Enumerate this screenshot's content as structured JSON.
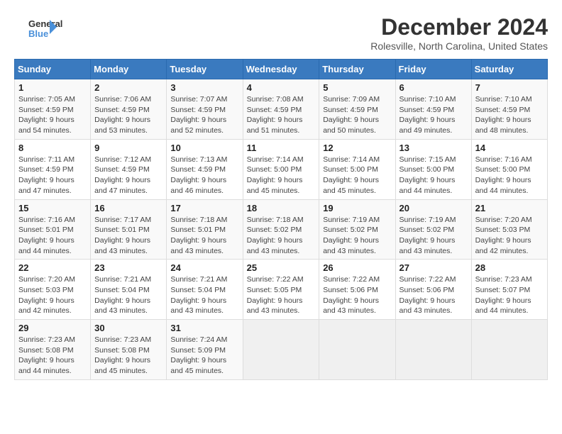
{
  "logo": {
    "text_general": "General",
    "text_blue": "Blue"
  },
  "header": {
    "month": "December 2024",
    "location": "Rolesville, North Carolina, United States"
  },
  "weekdays": [
    "Sunday",
    "Monday",
    "Tuesday",
    "Wednesday",
    "Thursday",
    "Friday",
    "Saturday"
  ],
  "weeks": [
    [
      {
        "day": "1",
        "sunrise": "7:05 AM",
        "sunset": "4:59 PM",
        "daylight": "9 hours and 54 minutes."
      },
      {
        "day": "2",
        "sunrise": "7:06 AM",
        "sunset": "4:59 PM",
        "daylight": "9 hours and 53 minutes."
      },
      {
        "day": "3",
        "sunrise": "7:07 AM",
        "sunset": "4:59 PM",
        "daylight": "9 hours and 52 minutes."
      },
      {
        "day": "4",
        "sunrise": "7:08 AM",
        "sunset": "4:59 PM",
        "daylight": "9 hours and 51 minutes."
      },
      {
        "day": "5",
        "sunrise": "7:09 AM",
        "sunset": "4:59 PM",
        "daylight": "9 hours and 50 minutes."
      },
      {
        "day": "6",
        "sunrise": "7:10 AM",
        "sunset": "4:59 PM",
        "daylight": "9 hours and 49 minutes."
      },
      {
        "day": "7",
        "sunrise": "7:10 AM",
        "sunset": "4:59 PM",
        "daylight": "9 hours and 48 minutes."
      }
    ],
    [
      {
        "day": "8",
        "sunrise": "7:11 AM",
        "sunset": "4:59 PM",
        "daylight": "9 hours and 47 minutes."
      },
      {
        "day": "9",
        "sunrise": "7:12 AM",
        "sunset": "4:59 PM",
        "daylight": "9 hours and 47 minutes."
      },
      {
        "day": "10",
        "sunrise": "7:13 AM",
        "sunset": "4:59 PM",
        "daylight": "9 hours and 46 minutes."
      },
      {
        "day": "11",
        "sunrise": "7:14 AM",
        "sunset": "5:00 PM",
        "daylight": "9 hours and 45 minutes."
      },
      {
        "day": "12",
        "sunrise": "7:14 AM",
        "sunset": "5:00 PM",
        "daylight": "9 hours and 45 minutes."
      },
      {
        "day": "13",
        "sunrise": "7:15 AM",
        "sunset": "5:00 PM",
        "daylight": "9 hours and 44 minutes."
      },
      {
        "day": "14",
        "sunrise": "7:16 AM",
        "sunset": "5:00 PM",
        "daylight": "9 hours and 44 minutes."
      }
    ],
    [
      {
        "day": "15",
        "sunrise": "7:16 AM",
        "sunset": "5:01 PM",
        "daylight": "9 hours and 44 minutes."
      },
      {
        "day": "16",
        "sunrise": "7:17 AM",
        "sunset": "5:01 PM",
        "daylight": "9 hours and 43 minutes."
      },
      {
        "day": "17",
        "sunrise": "7:18 AM",
        "sunset": "5:01 PM",
        "daylight": "9 hours and 43 minutes."
      },
      {
        "day": "18",
        "sunrise": "7:18 AM",
        "sunset": "5:02 PM",
        "daylight": "9 hours and 43 minutes."
      },
      {
        "day": "19",
        "sunrise": "7:19 AM",
        "sunset": "5:02 PM",
        "daylight": "9 hours and 43 minutes."
      },
      {
        "day": "20",
        "sunrise": "7:19 AM",
        "sunset": "5:02 PM",
        "daylight": "9 hours and 43 minutes."
      },
      {
        "day": "21",
        "sunrise": "7:20 AM",
        "sunset": "5:03 PM",
        "daylight": "9 hours and 42 minutes."
      }
    ],
    [
      {
        "day": "22",
        "sunrise": "7:20 AM",
        "sunset": "5:03 PM",
        "daylight": "9 hours and 42 minutes."
      },
      {
        "day": "23",
        "sunrise": "7:21 AM",
        "sunset": "5:04 PM",
        "daylight": "9 hours and 43 minutes."
      },
      {
        "day": "24",
        "sunrise": "7:21 AM",
        "sunset": "5:04 PM",
        "daylight": "9 hours and 43 minutes."
      },
      {
        "day": "25",
        "sunrise": "7:22 AM",
        "sunset": "5:05 PM",
        "daylight": "9 hours and 43 minutes."
      },
      {
        "day": "26",
        "sunrise": "7:22 AM",
        "sunset": "5:06 PM",
        "daylight": "9 hours and 43 minutes."
      },
      {
        "day": "27",
        "sunrise": "7:22 AM",
        "sunset": "5:06 PM",
        "daylight": "9 hours and 43 minutes."
      },
      {
        "day": "28",
        "sunrise": "7:23 AM",
        "sunset": "5:07 PM",
        "daylight": "9 hours and 44 minutes."
      }
    ],
    [
      {
        "day": "29",
        "sunrise": "7:23 AM",
        "sunset": "5:08 PM",
        "daylight": "9 hours and 44 minutes."
      },
      {
        "day": "30",
        "sunrise": "7:23 AM",
        "sunset": "5:08 PM",
        "daylight": "9 hours and 45 minutes."
      },
      {
        "day": "31",
        "sunrise": "7:24 AM",
        "sunset": "5:09 PM",
        "daylight": "9 hours and 45 minutes."
      },
      null,
      null,
      null,
      null
    ]
  ],
  "labels": {
    "sunrise": "Sunrise:",
    "sunset": "Sunset:",
    "daylight": "Daylight:"
  }
}
